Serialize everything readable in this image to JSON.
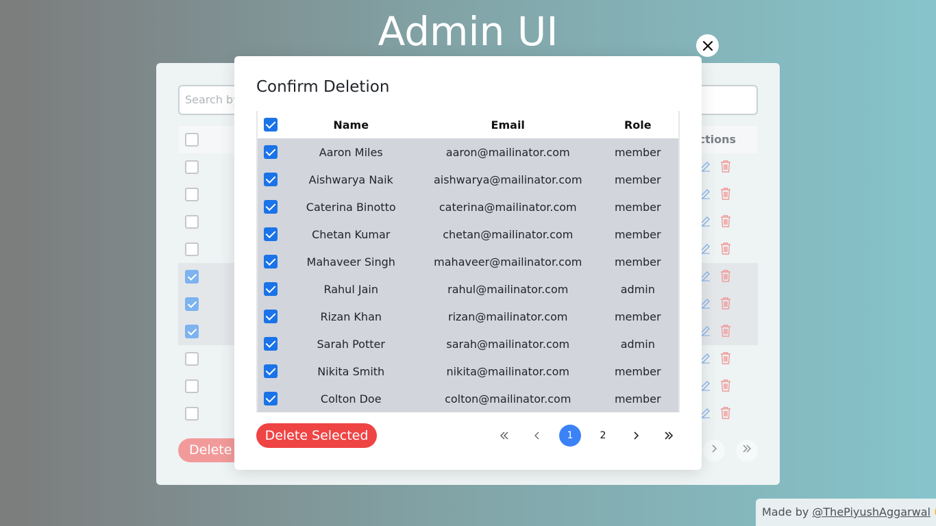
{
  "page": {
    "title": "Admin UI"
  },
  "background": {
    "search_placeholder": "Search by",
    "actions_header": "Actions",
    "rows_checked": [
      false,
      false,
      false,
      false,
      true,
      true,
      true,
      false,
      false,
      false
    ],
    "delete_label": "Delete"
  },
  "modal": {
    "title": "Confirm Deletion",
    "columns": {
      "name": "Name",
      "email": "Email",
      "role": "Role"
    },
    "rows": [
      {
        "name": "Aaron Miles",
        "email": "aaron@mailinator.com",
        "role": "member"
      },
      {
        "name": "Aishwarya Naik",
        "email": "aishwarya@mailinator.com",
        "role": "member"
      },
      {
        "name": "Caterina Binotto",
        "email": "caterina@mailinator.com",
        "role": "member"
      },
      {
        "name": "Chetan Kumar",
        "email": "chetan@mailinator.com",
        "role": "member"
      },
      {
        "name": "Mahaveer Singh",
        "email": "mahaveer@mailinator.com",
        "role": "member"
      },
      {
        "name": "Rahul Jain",
        "email": "rahul@mailinator.com",
        "role": "admin"
      },
      {
        "name": "Rizan Khan",
        "email": "rizan@mailinator.com",
        "role": "member"
      },
      {
        "name": "Sarah Potter",
        "email": "sarah@mailinator.com",
        "role": "admin"
      },
      {
        "name": "Nikita Smith",
        "email": "nikita@mailinator.com",
        "role": "member"
      },
      {
        "name": "Colton Doe",
        "email": "colton@mailinator.com",
        "role": "member"
      }
    ],
    "delete_button": "Delete Selected",
    "pagination": {
      "current": "1",
      "next_page": "2"
    }
  },
  "credit": {
    "prefix": "Made by ",
    "handle": "@ThePiyushAggarwal",
    "emoji": "🙂"
  },
  "colors": {
    "accent": "#3b82f6",
    "checkbox": "#1a73e8",
    "danger": "#ef4444"
  }
}
